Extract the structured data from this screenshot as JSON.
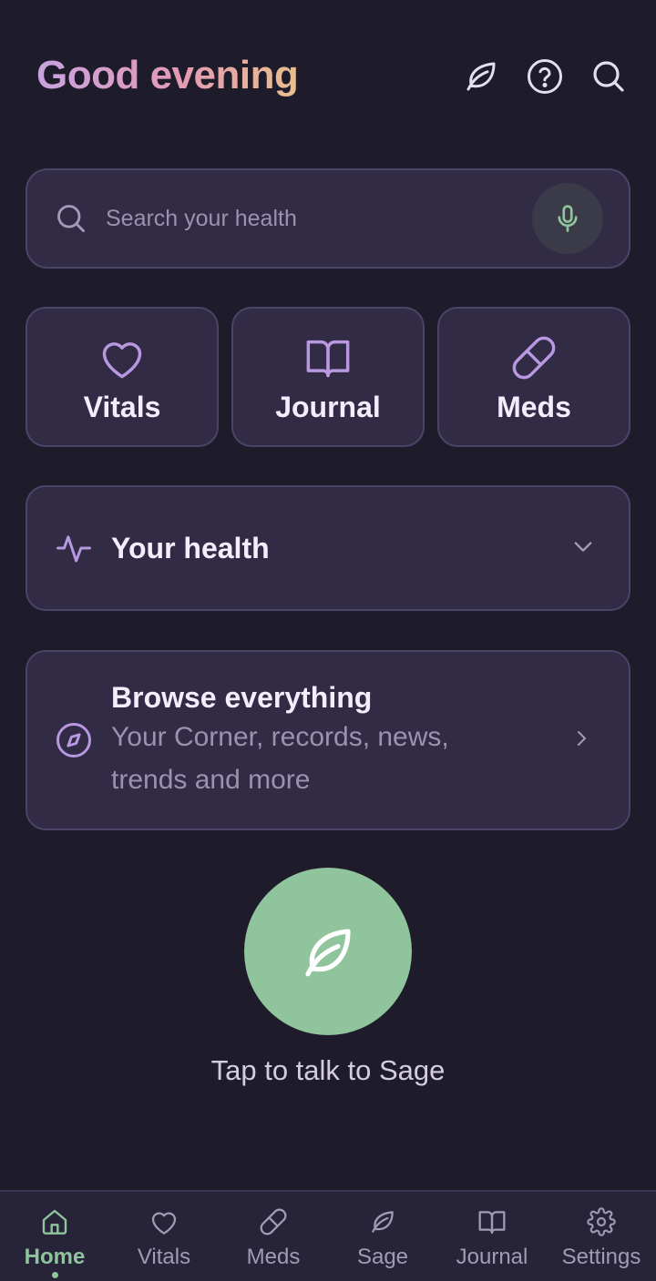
{
  "header": {
    "greeting": "Good evening",
    "icons": [
      "leaf-icon",
      "help-circle-icon",
      "search-icon"
    ]
  },
  "search": {
    "placeholder": "Search your health",
    "mic_icon": "microphone-icon"
  },
  "tiles": [
    {
      "label": "Vitals",
      "icon": "heart-icon"
    },
    {
      "label": "Journal",
      "icon": "book-open-icon"
    },
    {
      "label": "Meds",
      "icon": "pill-icon"
    }
  ],
  "health_section": {
    "label": "Your health",
    "icon": "activity-icon",
    "expanded": false
  },
  "browse": {
    "title": "Browse everything",
    "subtitle": "Your Corner, records, news, trends and more",
    "icon": "compass-icon"
  },
  "sage": {
    "caption": "Tap to talk to Sage",
    "icon": "leaf-icon"
  },
  "bottom_nav": {
    "items": [
      {
        "label": "Home",
        "icon": "home-icon",
        "active": true
      },
      {
        "label": "Vitals",
        "icon": "heart-icon",
        "active": false
      },
      {
        "label": "Meds",
        "icon": "pill-icon",
        "active": false
      },
      {
        "label": "Sage",
        "icon": "leaf-icon",
        "active": false
      },
      {
        "label": "Journal",
        "icon": "book-open-icon",
        "active": false
      },
      {
        "label": "Settings",
        "icon": "gear-icon",
        "active": false
      }
    ]
  },
  "colors": {
    "background": "#1e1b2b",
    "card": "#312b45",
    "card_border": "#4c4368",
    "accent_purple": "#b898e0",
    "accent_green": "#8fc49c",
    "muted_text": "#9a92ae"
  }
}
